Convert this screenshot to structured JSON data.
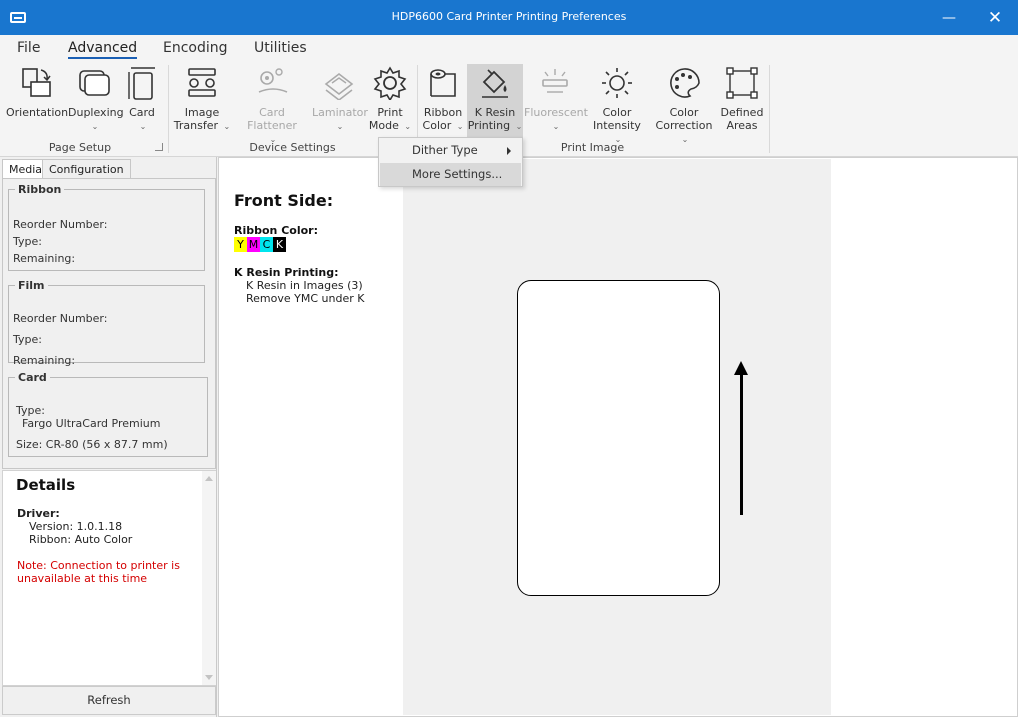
{
  "window": {
    "title": "HDP6600 Card Printer Printing Preferences"
  },
  "menu_tabs": [
    "File",
    "Advanced",
    "Encoding",
    "Utilities"
  ],
  "groups": {
    "page_setup": "Page Setup",
    "device_settings": "Device Settings",
    "print_image": "Print Image"
  },
  "tools": {
    "orientation": "Orientation",
    "duplexing": "Duplexing",
    "card": "Card",
    "image_transfer_1": "Image",
    "image_transfer_2": "Transfer",
    "card_flattener": "Card Flattener",
    "laminator": "Laminator",
    "print_mode_1": "Print",
    "print_mode_2": "Mode",
    "ribbon_color_1": "Ribbon",
    "ribbon_color_2": "Color",
    "k_resin_1": "K Resin",
    "k_resin_2": "Printing",
    "fluorescent": "Fluorescent",
    "color_intensity_1": "Color",
    "color_intensity_2": "Intensity",
    "color_correction_1": "Color",
    "color_correction_2": "Correction",
    "defined_areas_1": "Defined",
    "defined_areas_2": "Areas"
  },
  "dropdown": {
    "dither_type": "Dither Type",
    "more_settings": "More Settings..."
  },
  "side_tabs": {
    "media": "Media",
    "configuration": "Configuration"
  },
  "ribbon_group": {
    "title": "Ribbon",
    "reorder": "Reorder Number:",
    "type": "Type:",
    "remaining": "Remaining:"
  },
  "film_group": {
    "title": "Film",
    "reorder": "Reorder Number:",
    "type": "Type:",
    "remaining": "Remaining:"
  },
  "card_group": {
    "title": "Card",
    "type_label": "Type:",
    "type_value": "Fargo UltraCard Premium",
    "size": "Size: CR-80 (56 x 87.7 mm)"
  },
  "details": {
    "heading": "Details",
    "driver_label": "Driver:",
    "version": "Version: 1.0.1.18",
    "ribbon": "Ribbon: Auto Color",
    "note_1": "Note: Connection to printer is",
    "note_2": "unavailable at this time"
  },
  "refresh_label": "Refresh",
  "preview": {
    "front_title": "Front Side:",
    "ribbon_color_label": "Ribbon Color:",
    "ribbon_panels": [
      "Y",
      "M",
      "C",
      "K"
    ],
    "k_resin_label": "K Resin Printing:",
    "k_resin_line1": "K Resin in Images (3)",
    "k_resin_line2": "Remove YMC under K"
  },
  "colors": {
    "titlebar": "#1976cf",
    "accent_underline": "#1a5fb4",
    "note_text": "#d40000",
    "swatch_y": "#ffff00",
    "swatch_m": "#ff00ff",
    "swatch_c": "#00e5ee",
    "swatch_k": "#000000"
  }
}
